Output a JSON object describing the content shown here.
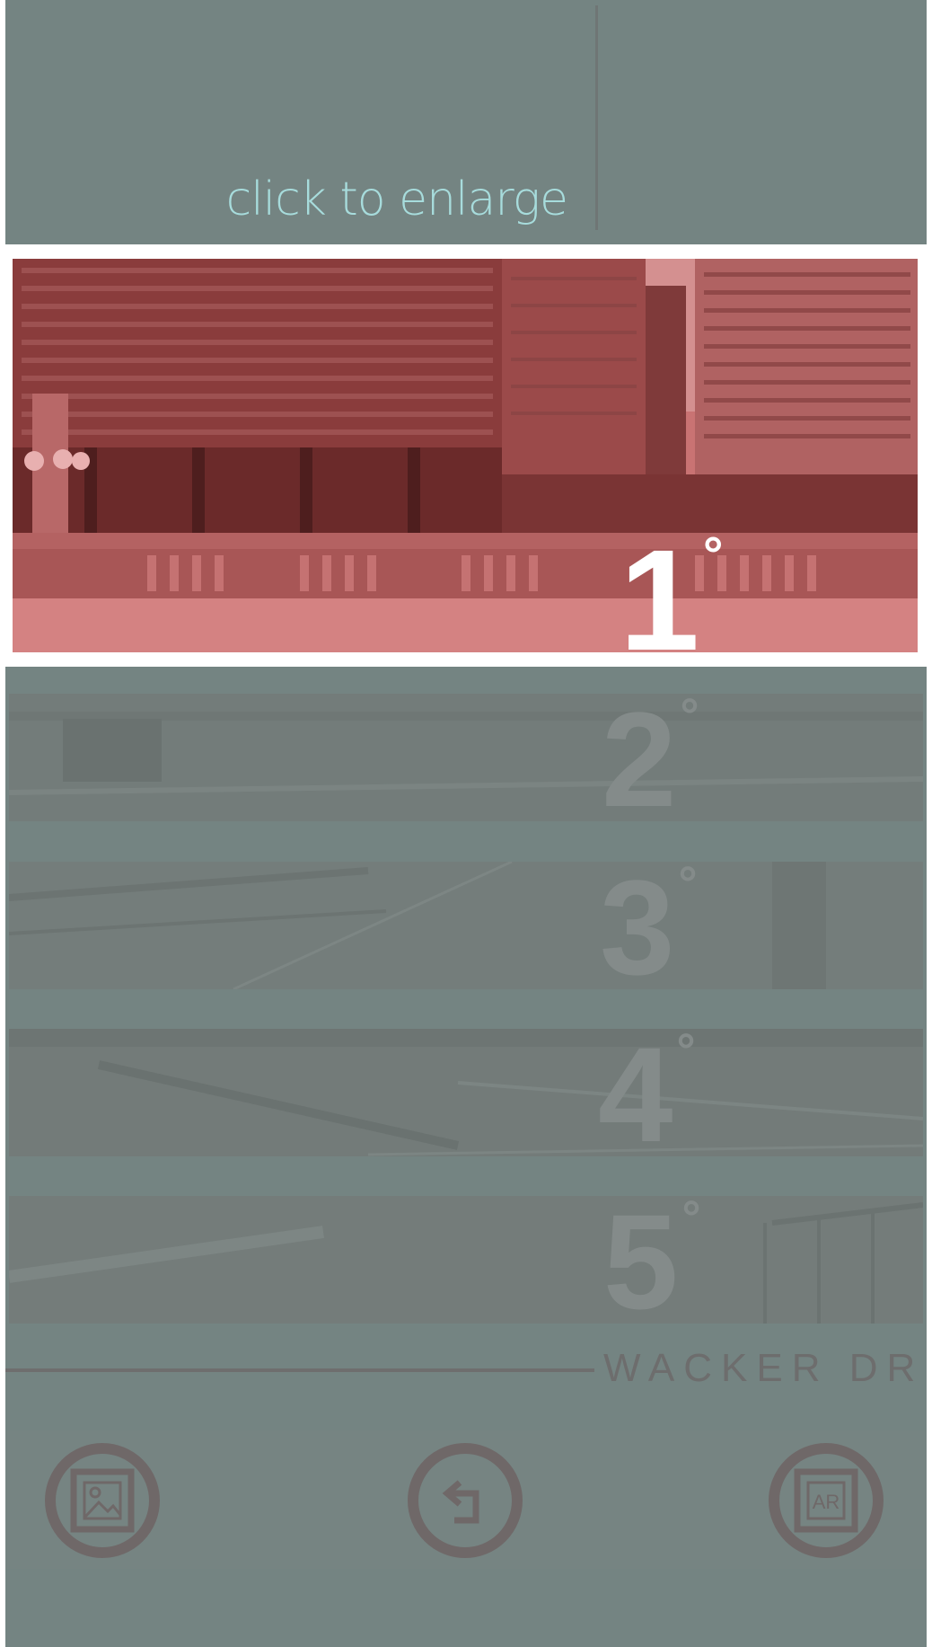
{
  "header": {
    "enlarge_label": "click to enlarge"
  },
  "main_view": {
    "level": "1",
    "level_unit": "°",
    "accent": "#ffffff"
  },
  "levels": [
    {
      "number": "2",
      "unit": "°"
    },
    {
      "number": "3",
      "unit": "°"
    },
    {
      "number": "4",
      "unit": "°"
    },
    {
      "number": "5",
      "unit": "°"
    }
  ],
  "street": {
    "label": "WACKER DR"
  },
  "toolbar": {
    "gallery_icon": "gallery-icon",
    "back_icon": "back-icon",
    "ar_icon_label": "AR"
  },
  "colors": {
    "panel": "#748482",
    "enlarge_text": "#a7dcdc",
    "photo_tint": "#c86e6e"
  }
}
